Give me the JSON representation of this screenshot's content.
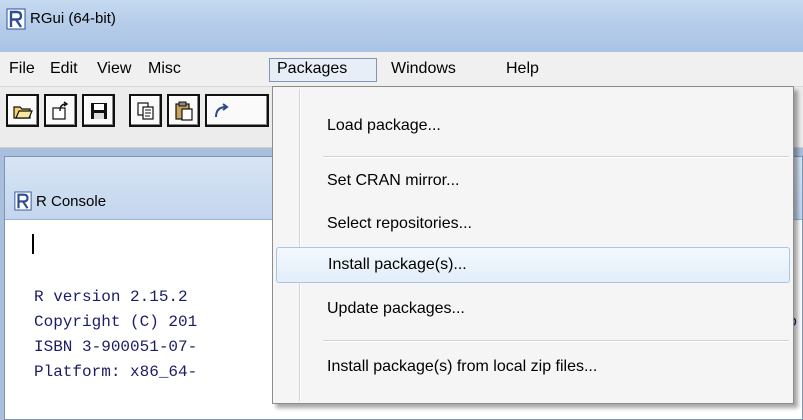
{
  "window": {
    "title": "RGui (64-bit)"
  },
  "menubar": {
    "items": [
      "File",
      "Edit",
      "View",
      "Misc",
      "Packages",
      "Windows",
      "Help"
    ],
    "active": "Packages"
  },
  "toolbar": {
    "buttons": [
      "open-script-icon",
      "load-workspace-icon",
      "save-icon",
      "copy-icon",
      "paste-icon",
      "copy-paste-icon"
    ]
  },
  "console": {
    "title": "R Console",
    "lines": [
      "R version 2.15.2",
      "Copyright (C) 201",
      "ISBN 3-900051-07-",
      "Platform: x86_64-"
    ],
    "overflow_fragment": "Co"
  },
  "packages_menu": {
    "items": [
      "Load package...",
      "Set CRAN mirror...",
      "Select repositories...",
      "Install package(s)...",
      "Update packages...",
      "Install package(s) from local zip files..."
    ],
    "highlighted": "Install package(s)..."
  },
  "colors": {
    "titlebar": "#b6cde9",
    "mdi_background": "#a9bfdc",
    "console_text": "#1c1c66",
    "menu_highlight_border": "#a9c6e5"
  }
}
